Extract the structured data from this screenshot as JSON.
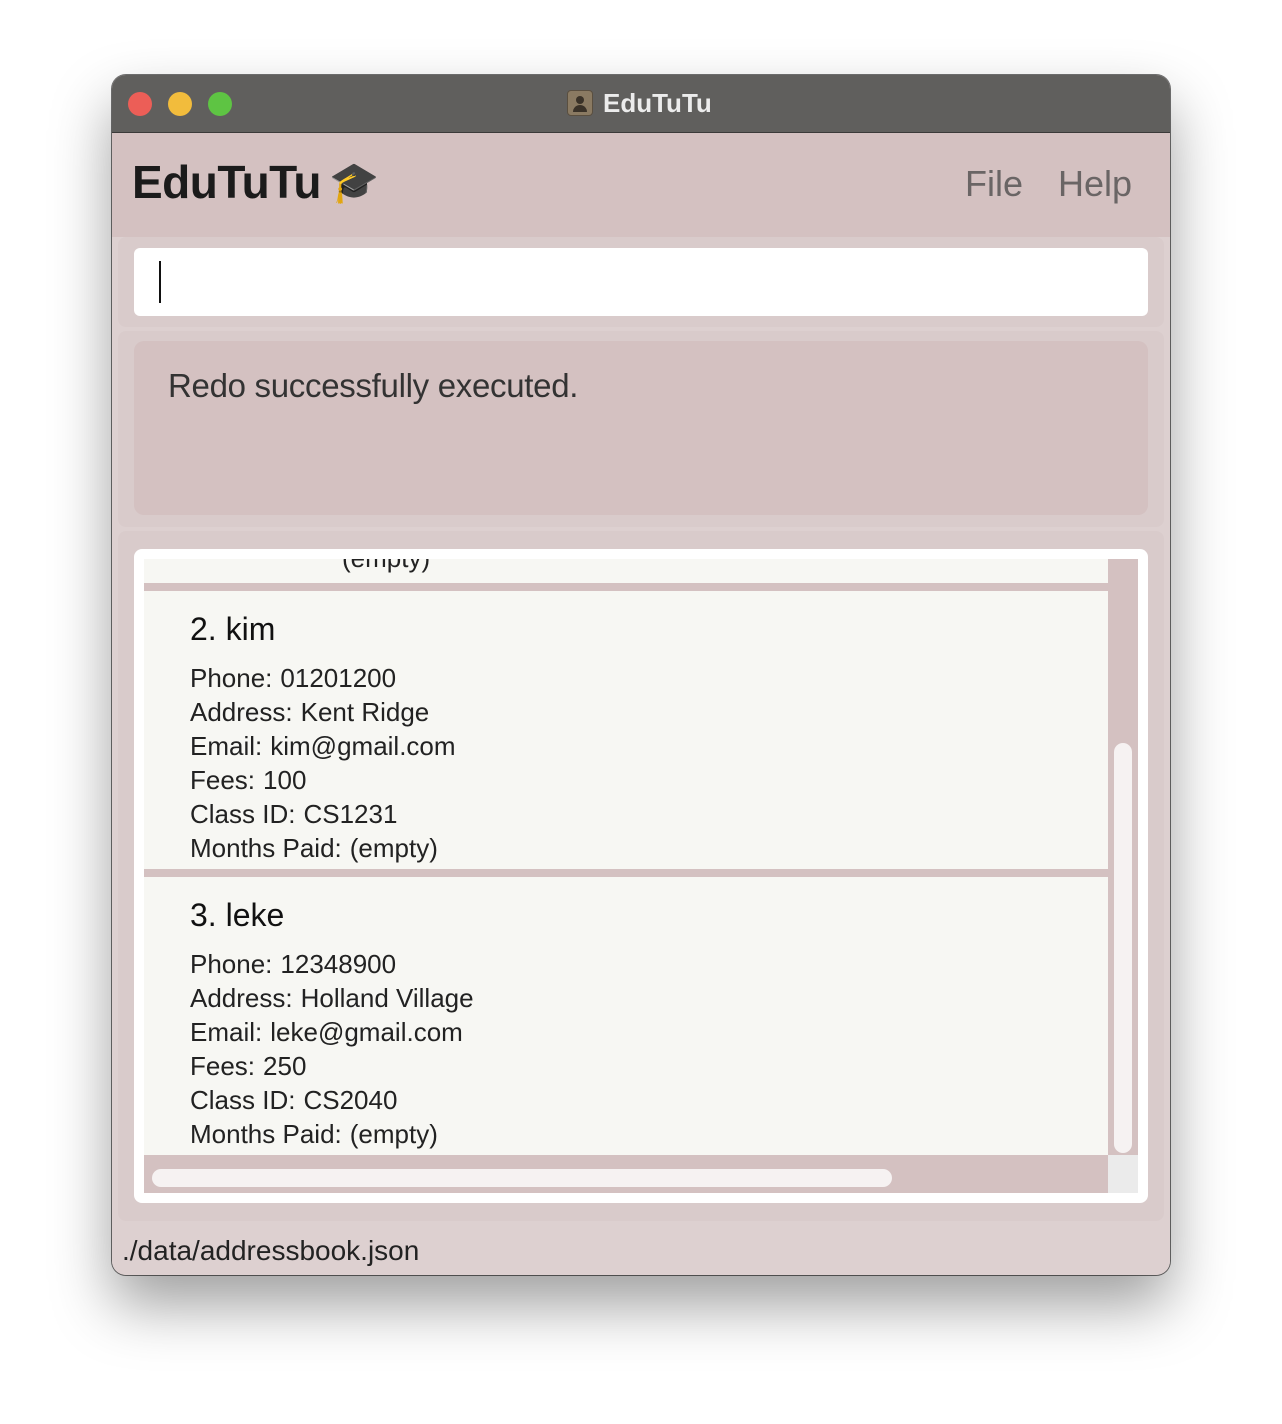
{
  "window": {
    "title": "EduTuTu"
  },
  "menubar": {
    "brand": "EduTuTu",
    "brand_icon": "graduation-cap-icon",
    "menus": [
      "File",
      "Help"
    ]
  },
  "command": {
    "value": "",
    "placeholder": ""
  },
  "result": {
    "message": "Redo successfully executed."
  },
  "list": {
    "partial_above_text": "(empty)",
    "persons": [
      {
        "title": "2. kim",
        "phone_label": "Phone:",
        "phone": "01201200",
        "address_label": "Address:",
        "address": "Kent Ridge",
        "email_label": "Email:",
        "email": "kim@gmail.com",
        "fees_label": "Fees:",
        "fees": "100",
        "class_label": "Class ID:",
        "class_id": "CS1231",
        "months_label": "Months Paid:",
        "months_paid": "(empty)"
      },
      {
        "title": "3. leke",
        "phone_label": "Phone:",
        "phone": "12348900",
        "address_label": "Address:",
        "address": "Holland Village",
        "email_label": "Email:",
        "email": "leke@gmail.com",
        "fees_label": "Fees:",
        "fees": "250",
        "class_label": "Class ID:",
        "class_id": "CS2040",
        "months_label": "Months Paid:",
        "months_paid": "(empty)"
      }
    ]
  },
  "status": {
    "file_path": "./data/addressbook.json"
  },
  "colors": {
    "titlebar": "#605f5d",
    "panel": "#d4c1c1",
    "card": "#f7f7f3",
    "close": "#ec5e57",
    "minimize": "#f2bc3c",
    "maximize": "#5ec443"
  }
}
